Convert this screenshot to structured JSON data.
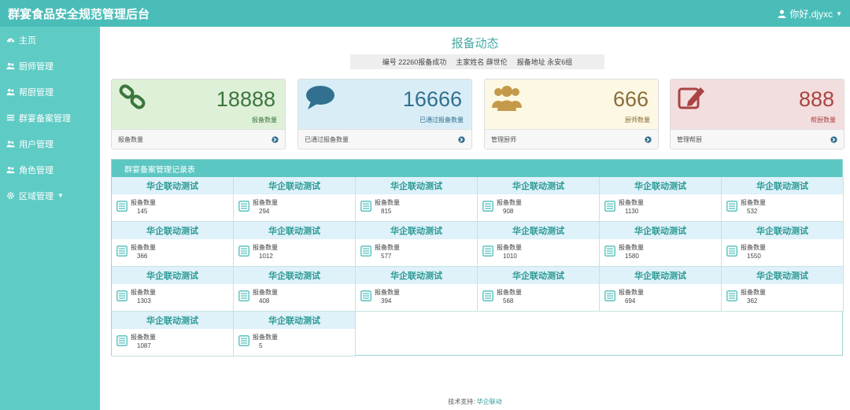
{
  "app": {
    "title": "群宴食品安全规范管理后台"
  },
  "user": {
    "greeting": "你好,djyxc"
  },
  "sidebar": {
    "items": [
      {
        "label": "主页",
        "icon": "dashboard-icon"
      },
      {
        "label": "厨师管理",
        "icon": "users-icon"
      },
      {
        "label": "帮厨管理",
        "icon": "users-icon"
      },
      {
        "label": "群宴备案管理",
        "icon": "list-icon"
      },
      {
        "label": "用户管理",
        "icon": "users-icon"
      },
      {
        "label": "角色管理",
        "icon": "users-icon"
      },
      {
        "label": "区域管理",
        "icon": "gear-icon"
      }
    ]
  },
  "main": {
    "title": "报备动态",
    "notice": {
      "seg1": "编号 22260报备成功",
      "seg2": "主家姓名 薛世伦",
      "seg3": "报备地址 永安6组"
    }
  },
  "cards": [
    {
      "number": "18888",
      "subtitle": "报备数量",
      "footer": "报备数量",
      "icon": "link-icon",
      "bg": "#dff0d8",
      "color": "#3c763d"
    },
    {
      "number": "16666",
      "subtitle": "已通过报备数量",
      "footer": "已通过报备数量",
      "icon": "comment-icon",
      "bg": "#d9edf7",
      "color": "#31708f"
    },
    {
      "number": "666",
      "subtitle": "厨师数量",
      "footer": "管理厨师",
      "icon": "group-icon",
      "bg": "#fcf8e3",
      "color": "#8a6d3b"
    },
    {
      "number": "888",
      "subtitle": "帮厨数量",
      "footer": "管理帮厨",
      "icon": "edit-icon",
      "bg": "#f2dede",
      "color": "#a94442"
    }
  ],
  "records": {
    "title": "群宴备案管理记录表",
    "item_label": "报备数量",
    "items": [
      {
        "name": "华企联动测试",
        "count": "145"
      },
      {
        "name": "华企联动测试",
        "count": "294"
      },
      {
        "name": "华企联动测试",
        "count": "815"
      },
      {
        "name": "华企联动测试",
        "count": "908"
      },
      {
        "name": "华企联动测试",
        "count": "1130"
      },
      {
        "name": "华企联动测试",
        "count": "532"
      },
      {
        "name": "华企联动测试",
        "count": "366"
      },
      {
        "name": "华企联动测试",
        "count": "1012"
      },
      {
        "name": "华企联动测试",
        "count": "577"
      },
      {
        "name": "华企联动测试",
        "count": "1010"
      },
      {
        "name": "华企联动测试",
        "count": "1580"
      },
      {
        "name": "华企联动测试",
        "count": "1550"
      },
      {
        "name": "华企联动测试",
        "count": "1303"
      },
      {
        "name": "华企联动测试",
        "count": "408"
      },
      {
        "name": "华企联动测试",
        "count": "394"
      },
      {
        "name": "华企联动测试",
        "count": "568"
      },
      {
        "name": "华企联动测试",
        "count": "694"
      },
      {
        "name": "华企联动测试",
        "count": "362"
      },
      {
        "name": "华企联动测试",
        "count": "1087"
      },
      {
        "name": "华企联动测试",
        "count": "5"
      }
    ]
  },
  "footer": {
    "label": "技术支持:",
    "link": "华企联动"
  }
}
